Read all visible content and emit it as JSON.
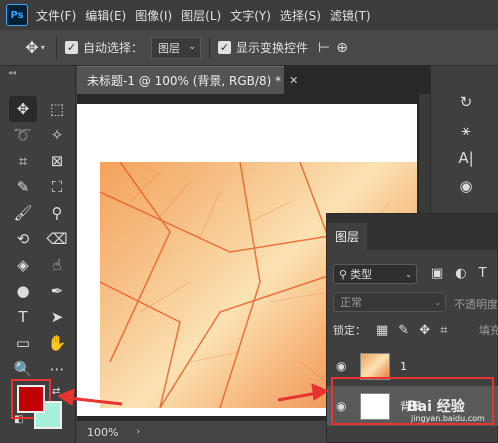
{
  "app": {
    "logo": "Ps"
  },
  "menu": [
    "文件(F)",
    "编辑(E)",
    "图像(I)",
    "图层(L)",
    "文字(Y)",
    "选择(S)",
    "滤镜(T)"
  ],
  "options": {
    "auto_select_label": "自动选择：",
    "auto_select_value": "图层",
    "show_transform_label": "显示变换控件"
  },
  "document": {
    "tab_title": "未标题-1 @ 100% (背景, RGB/8) *",
    "zoom": "100%"
  },
  "colors": {
    "foreground": "#c00000",
    "background": "#a6f0dc",
    "highlight": "#e8332f"
  },
  "layers_panel": {
    "tab": "图层",
    "filter_label": "类型",
    "blend_mode": "正常",
    "opacity_label": "不透明度",
    "lock_label": "锁定：",
    "fill_label": "填充",
    "layers": [
      {
        "name": "1",
        "thumb": "leaf-image"
      },
      {
        "name": "背景",
        "thumb": "white",
        "selected": true
      }
    ]
  },
  "watermark": {
    "text": "Bai 经验",
    "sub": "jingyan.baidu.com"
  }
}
